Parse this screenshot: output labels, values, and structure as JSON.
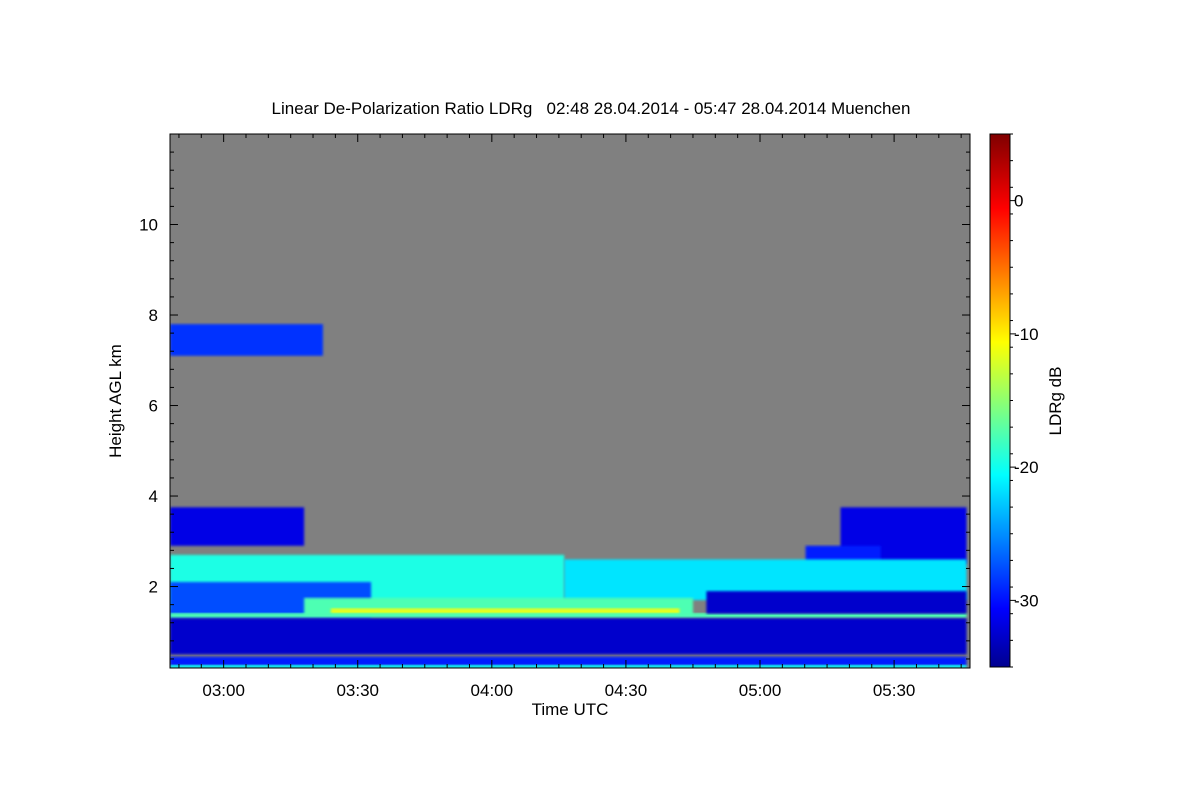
{
  "chart_data": {
    "type": "heatmap",
    "title": "Linear De-Polarization Ratio LDRg   02:48 28.04.2014 - 05:47 28.04.2014 Muenchen",
    "xlabel": "Time UTC",
    "ylabel": "Height AGL km",
    "x_unit": "hour UTC",
    "x_range": [
      2.8,
      5.783
    ],
    "y_range": [
      0.2,
      12.0
    ],
    "x_ticks": [
      {
        "value": 3.0,
        "label": "03:00"
      },
      {
        "value": 3.5,
        "label": "03:30"
      },
      {
        "value": 4.0,
        "label": "04:00"
      },
      {
        "value": 4.5,
        "label": "04:30"
      },
      {
        "value": 5.0,
        "label": "05:00"
      },
      {
        "value": 5.5,
        "label": "05:30"
      }
    ],
    "y_ticks": [
      {
        "value": 2,
        "label": "2"
      },
      {
        "value": 4,
        "label": "4"
      },
      {
        "value": 6,
        "label": "6"
      },
      {
        "value": 8,
        "label": "8"
      },
      {
        "value": 10,
        "label": "10"
      }
    ],
    "colorbar": {
      "label": "LDRg dB",
      "range": [
        -35,
        5
      ],
      "ticks": [
        {
          "value": 0,
          "label": "0"
        },
        {
          "value": -10,
          "label": "-10"
        },
        {
          "value": -20,
          "label": "-20"
        },
        {
          "value": -30,
          "label": "-30"
        }
      ],
      "colormap": "jet"
    },
    "no_data_color": "#808080",
    "regions": [
      {
        "t0": 2.8,
        "t1": 3.37,
        "h0": 7.1,
        "h1": 7.8,
        "ldr": -28
      },
      {
        "t0": 2.8,
        "t1": 3.3,
        "h0": 2.9,
        "h1": 3.75,
        "ldr": -31
      },
      {
        "t0": 5.3,
        "t1": 5.77,
        "h0": 2.5,
        "h1": 3.75,
        "ldr": -31
      },
      {
        "t0": 5.17,
        "t1": 5.45,
        "h0": 2.2,
        "h1": 2.9,
        "ldr": -29
      },
      {
        "t0": 2.8,
        "t1": 4.27,
        "h0": 1.5,
        "h1": 2.7,
        "ldr": -19
      },
      {
        "t0": 4.27,
        "t1": 5.77,
        "h0": 1.7,
        "h1": 2.6,
        "ldr": -21
      },
      {
        "t0": 2.8,
        "t1": 3.55,
        "h0": 1.3,
        "h1": 2.1,
        "ldr": -27
      },
      {
        "t0": 3.3,
        "t1": 4.75,
        "h0": 1.35,
        "h1": 1.75,
        "ldr": -17
      },
      {
        "t0": 3.4,
        "t1": 4.7,
        "h0": 1.38,
        "h1": 1.52,
        "ldr": -11
      },
      {
        "t0": 2.8,
        "t1": 5.77,
        "h0": 1.3,
        "h1": 1.42,
        "ldr": -17
      },
      {
        "t0": 2.8,
        "t1": 5.77,
        "h0": 0.5,
        "h1": 1.3,
        "ldr": -32
      },
      {
        "t0": 4.8,
        "t1": 5.77,
        "h0": 1.4,
        "h1": 1.9,
        "ldr": -32
      },
      {
        "t0": 2.8,
        "t1": 5.77,
        "h0": 0.25,
        "h1": 0.45,
        "ldr": -29
      },
      {
        "t0": 2.8,
        "t1": 5.77,
        "h0": 0.2,
        "h1": 0.27,
        "ldr": -20
      }
    ]
  }
}
